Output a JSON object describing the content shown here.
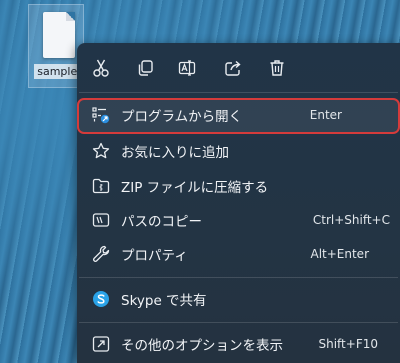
{
  "desktop": {
    "file_name": "sample."
  },
  "toolbar": [
    {
      "name": "cut-button",
      "icon": "scissors-icon"
    },
    {
      "name": "copy-button",
      "icon": "copy-icon"
    },
    {
      "name": "rename-button",
      "icon": "rename-icon"
    },
    {
      "name": "share-button",
      "icon": "share-icon"
    },
    {
      "name": "delete-button",
      "icon": "trash-icon"
    }
  ],
  "menu": {
    "open_with": {
      "label": "プログラムから開く",
      "shortcut": "Enter"
    },
    "favorites": {
      "label": "お気に入りに追加"
    },
    "zip": {
      "label": "ZIP ファイルに圧縮する"
    },
    "copy_path": {
      "label": "パスのコピー",
      "shortcut": "Ctrl+Shift+C"
    },
    "properties": {
      "label": "プロパティ",
      "shortcut": "Alt+Enter"
    },
    "skype": {
      "label": "Skype で共有"
    },
    "more_options": {
      "label": "その他のオプションを表示",
      "shortcut": "Shift+F10"
    }
  },
  "colors": {
    "highlight_border": "#d53b3b",
    "menu_background": "#223545",
    "skype_blue": "#2aa3e8"
  }
}
